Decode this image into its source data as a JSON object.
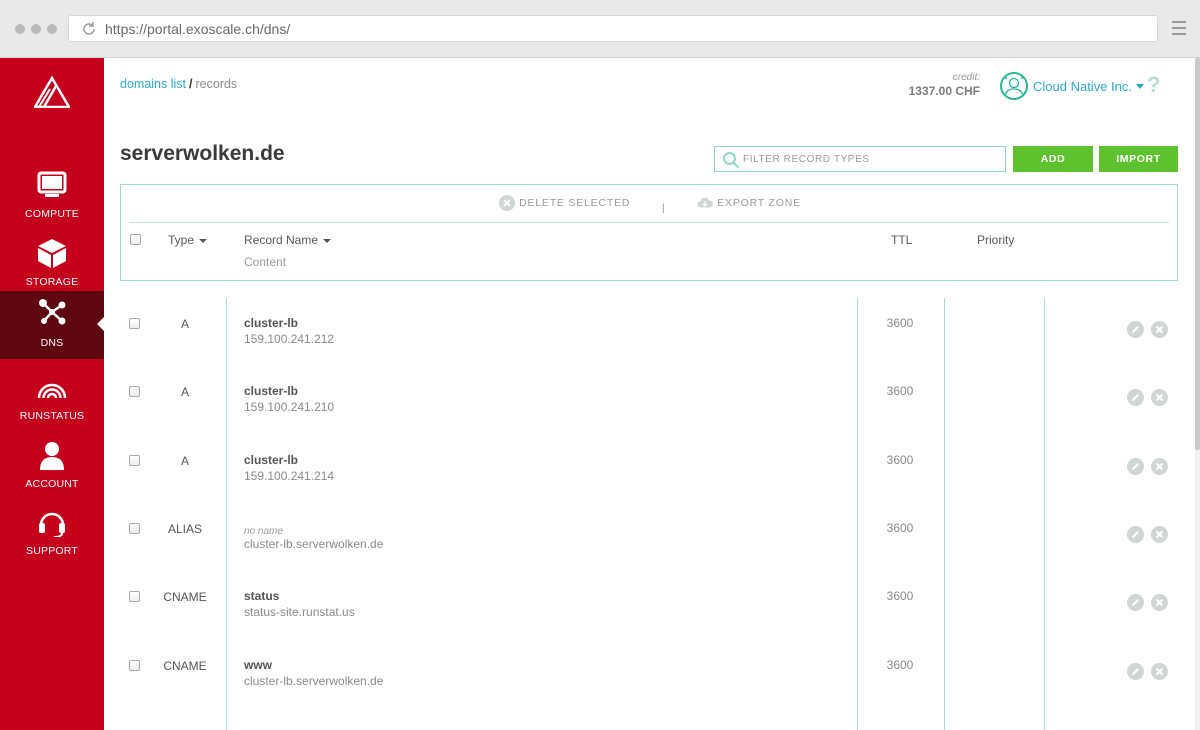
{
  "browser": {
    "url": "https://portal.exoscale.ch/dns/"
  },
  "sidebar": {
    "items": [
      {
        "label": "COMPUTE",
        "icon": "monitor-icon"
      },
      {
        "label": "STORAGE",
        "icon": "cube-icon"
      },
      {
        "label": "DNS",
        "icon": "network-nodes-icon",
        "active": true
      },
      {
        "label": "RUNSTATUS",
        "icon": "signal-waves-icon"
      },
      {
        "label": "ACCOUNT",
        "icon": "user-icon"
      },
      {
        "label": "SUPPORT",
        "icon": "headset-icon"
      }
    ]
  },
  "header": {
    "breadcrumb": {
      "link": "domains list",
      "separator": "/",
      "current": "records"
    },
    "credit_label": "credit:",
    "credit_value": "1337.00 CHF",
    "account_name": "Cloud Native Inc.",
    "help": "?"
  },
  "page": {
    "title": "serverwolken.de",
    "filter_placeholder": "FILTER RECORD TYPES",
    "add_label": "ADD",
    "import_label": "IMPORT"
  },
  "table": {
    "delete_selected": "DELETE SELECTED",
    "divider": "|",
    "export_zone": "EXPORT ZONE",
    "headers": {
      "type": "Type",
      "record_name": "Record Name",
      "content": "Content",
      "ttl": "TTL",
      "priority": "Priority"
    },
    "rows": [
      {
        "type": "A",
        "name": "cluster-lb",
        "content": "159.100.241.212",
        "ttl": "3600"
      },
      {
        "type": "A",
        "name": "cluster-lb",
        "content": "159.100.241.210",
        "ttl": "3600"
      },
      {
        "type": "A",
        "name": "cluster-lb",
        "content": "159.100.241.214",
        "ttl": "3600"
      },
      {
        "type": "ALIAS",
        "name": "no name",
        "content": "cluster-lb.serverwolken.de",
        "ttl": "3600"
      },
      {
        "type": "CNAME",
        "name": "status",
        "content": "status-site.runstat.us",
        "ttl": "3600"
      },
      {
        "type": "CNAME",
        "name": "www",
        "content": "cluster-lb.serverwolken.de",
        "ttl": "3600"
      }
    ]
  },
  "colors": {
    "brand": "#c4001c",
    "accent": "#2aa8cf",
    "success": "#5ec12e",
    "teal": "#9ee0cf"
  }
}
